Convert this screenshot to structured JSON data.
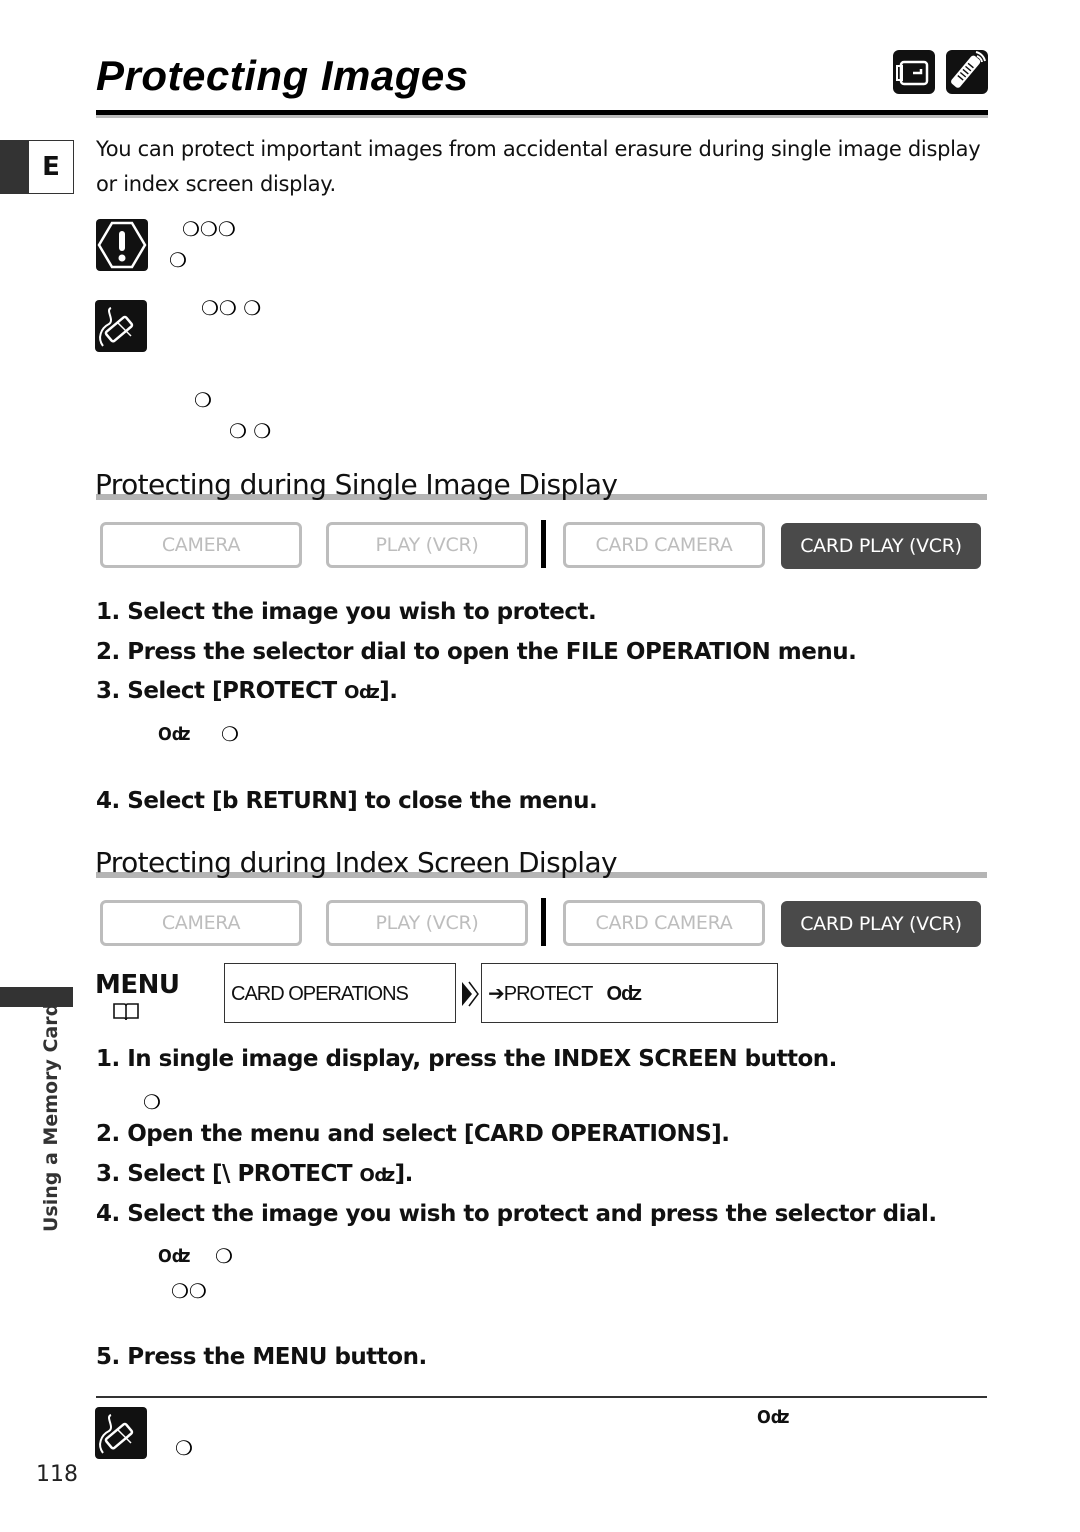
{
  "page": {
    "title": "Protecting Images",
    "language_tab": "E",
    "side_label": "Using a Memory Card",
    "page_number": "118",
    "header_icons": [
      "camcorder-icon",
      "remote-control-icon"
    ]
  },
  "intro": {
    "text": "You can protect important images from accidental erasure during single image display or index screen display."
  },
  "caution": {
    "icon": "caution-icon",
    "line1": "❍❍❍",
    "line2": "❍"
  },
  "note1": {
    "icon": "note-pencil-icon",
    "line1": "❍❍  ❍",
    "line2": "❍",
    "line3": "❍ ❍"
  },
  "section_single": {
    "heading": "Protecting during Single Image Display",
    "modes": [
      {
        "label": "CAMERA",
        "active": false
      },
      {
        "label": "PLAY (VCR)",
        "active": false
      },
      {
        "label": "CARD CAMERA",
        "active": false
      },
      {
        "label": "CARD PLAY (VCR)",
        "active": true
      }
    ],
    "steps": [
      "1. Select the image you wish to protect.",
      "2. Press the selector dial to open the FILE OPERATION menu.",
      "3. Select [PROTECT ",
      "4. Select [b   RETURN] to close the menu."
    ],
    "step3_suffix": "].",
    "sub_glyph": "❍",
    "key_glyph": "⊶"
  },
  "section_index": {
    "heading": "Protecting during Index Screen Display",
    "modes": [
      {
        "label": "CAMERA",
        "active": false
      },
      {
        "label": "PLAY (VCR)",
        "active": false
      },
      {
        "label": "CARD CAMERA",
        "active": false
      },
      {
        "label": "CARD PLAY (VCR)",
        "active": true
      }
    ],
    "menu_label": "MENU",
    "menu_book_icon": "book-icon",
    "menu_path": [
      "CARD OPERATIONS",
      "➔PROTECT"
    ],
    "steps": [
      "1. In single image display, press the INDEX SCREEN button.",
      "2. Open the menu and select [CARD OPERATIONS].",
      "3. Select [\\   PROTECT ",
      "4. Select the image you wish to protect and press the selector dial.",
      "5. Press the MENU button."
    ],
    "step3_suffix": "].",
    "sub_glyph_1": "❍",
    "sub_glyph_4a": "❍",
    "sub_glyph_4b": "❍❍"
  },
  "note2": {
    "icon": "note-pencil-icon",
    "line1": "❍"
  }
}
